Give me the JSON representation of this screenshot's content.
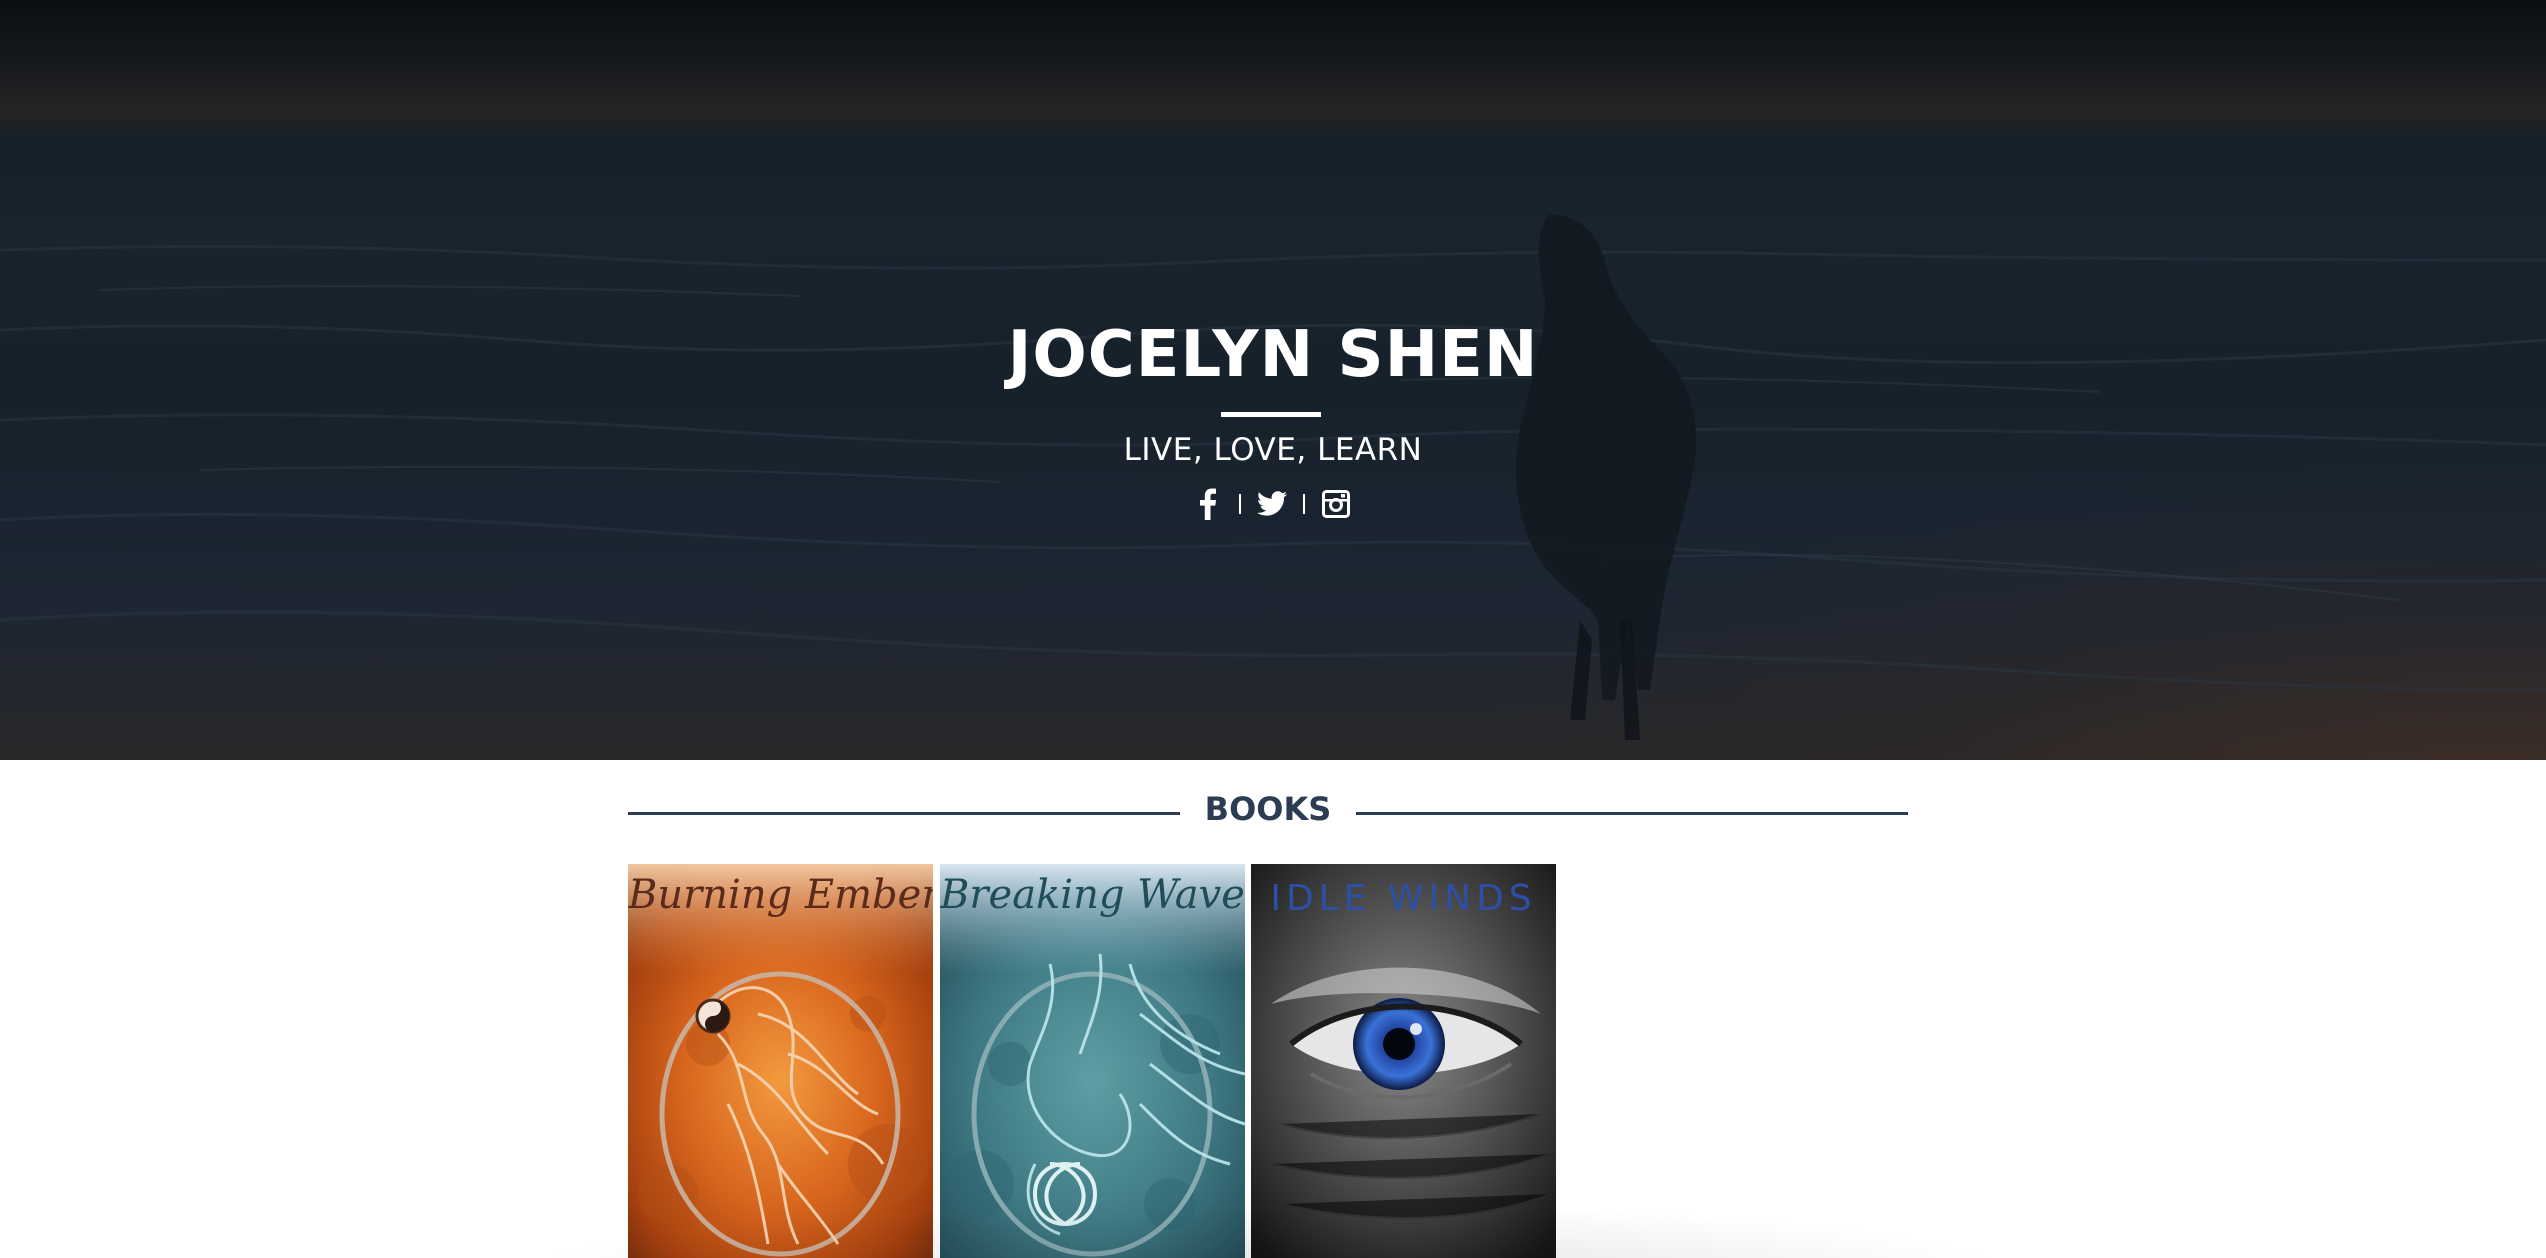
{
  "hero": {
    "title": "JOCELYN SHEN",
    "tagline": "LIVE, LOVE, LEARN",
    "social": {
      "facebook_icon": "facebook-icon",
      "twitter_icon": "twitter-icon",
      "instagram_icon": "instagram-icon"
    }
  },
  "books_section": {
    "heading": "BOOKS",
    "books": [
      {
        "title": "Burning Ember",
        "icon": "phoenix-emblem"
      },
      {
        "title": "Breaking Waves",
        "icon": "celtic-seahorse-emblem"
      },
      {
        "title": "IDLE WINDS",
        "icon": "blue-eye"
      }
    ]
  },
  "colors": {
    "heading_navy": "#2b3c53",
    "hero_text": "#ffffff"
  }
}
